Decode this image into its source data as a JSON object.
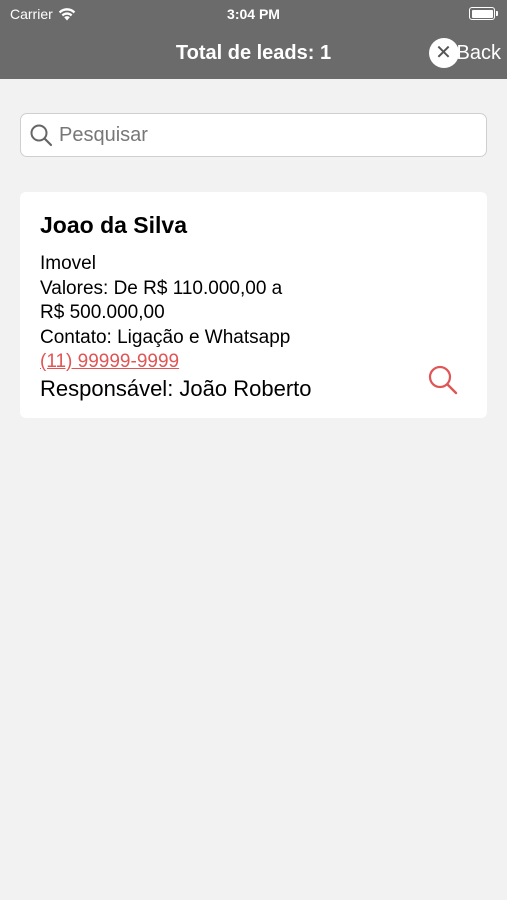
{
  "status_bar": {
    "carrier": "Carrier",
    "time": "3:04 PM",
    "wifi_icon": "wifi-icon",
    "battery_icon": "battery-icon"
  },
  "nav": {
    "title": "Total de leads: 1",
    "back_label": "Back",
    "back_icon": "close-icon",
    "background": "#6b6b6b"
  },
  "search": {
    "placeholder": "Pesquisar",
    "value": "",
    "icon": "search-icon"
  },
  "leads": [
    {
      "name": "Joao da Silva",
      "type": "Imovel",
      "values_line1": "Valores: De R$ 110.000,00 a",
      "values_line2": "R$ 500.000,00",
      "contact": "Contato: Ligação e Whatsapp",
      "phone": "(11) 99999-9999",
      "responsible": "Responsável: João Roberto",
      "action_icon": "search-icon",
      "accent_color": "#e05555"
    }
  ]
}
